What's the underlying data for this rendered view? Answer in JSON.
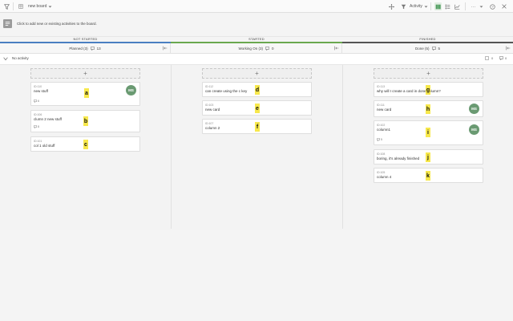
{
  "topbar": {
    "board_name": "new board",
    "activity_label": "Activity",
    "more_label": "..."
  },
  "hint": {
    "text": "Click to add new or existing activities to the board."
  },
  "columns": [
    {
      "name": "NOT STARTED",
      "sub": "Planned (3)",
      "count": "13",
      "color": "#4a7fc1"
    },
    {
      "name": "STARTED",
      "sub": "Working On (3)",
      "count": "0",
      "color": "#6aa84f"
    },
    {
      "name": "FINISHED",
      "sub": "Done (5)",
      "count": "5",
      "color": "#555555"
    }
  ],
  "activity_row": {
    "label": "No activity",
    "counts": [
      "0",
      "0"
    ]
  },
  "cards": [
    {
      "id": "ID:110",
      "title": "new stuff",
      "comments": "6",
      "avatar": "MS",
      "marker": "a"
    },
    {
      "id": "ID:106",
      "title": "clumn 2 new stuff",
      "comments": "8",
      "marker": "b"
    },
    {
      "id": "ID:101",
      "title": "col 1 old stuff",
      "marker": "c"
    },
    {
      "id": "ID:112",
      "title": "can create using the c key",
      "marker": "d"
    },
    {
      "id": "ID:103",
      "title": "new card",
      "marker": "e"
    },
    {
      "id": "ID:107",
      "title": "column 2",
      "marker": "f"
    },
    {
      "id": "ID:113",
      "title": "why will I create a card in done column?",
      "marker": "g"
    },
    {
      "id": "ID:111",
      "title": "new card",
      "avatar": "MS",
      "marker": "h"
    },
    {
      "id": "ID:102",
      "title": "column1",
      "comments": "5",
      "avatar": "MS",
      "marker": "i"
    },
    {
      "id": "ID:108",
      "title": "boring, it's already finished",
      "marker": "j"
    },
    {
      "id": "ID:105",
      "title": "column 4",
      "marker": "k"
    }
  ],
  "colors": {
    "avatar": "#6a9a72",
    "marker": "#f7e84c"
  }
}
